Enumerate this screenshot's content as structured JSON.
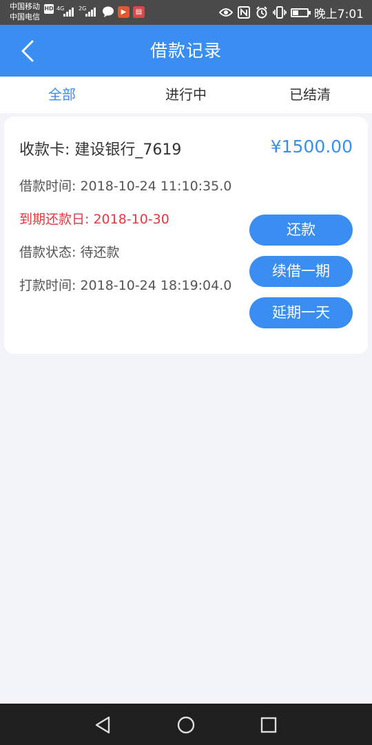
{
  "status_bar": {
    "carrier_1": "中国移动",
    "carrier_2": "中国电信",
    "hd_badge": "HD",
    "net_1": "4G",
    "net_2": "2G",
    "battery_level": 0.4,
    "time": "晚上7:01"
  },
  "header": {
    "title": "借款记录",
    "back_icon": "chevron-left-icon"
  },
  "tabs": [
    {
      "label": "全部",
      "active": true
    },
    {
      "label": "进行中",
      "active": false
    },
    {
      "label": "已结清",
      "active": false
    }
  ],
  "loan": {
    "card_label": "收款卡: 建设银行_7619",
    "amount": "¥1500.00",
    "borrow_time": "借款时间: 2018-10-24 11:10:35.0",
    "due_date": "到期还款日: 2018-10-30",
    "status": "借款状态: 待还款",
    "pay_time": "打款时间: 2018-10-24 18:19:04.0",
    "actions": {
      "repay": "还款",
      "renew": "续借一期",
      "extend": "延期一天"
    }
  },
  "colors": {
    "accent": "#3a8ef2",
    "due": "#e0393e",
    "status_bar": "#4a4a4a",
    "nav_bar": "#1f1f1f"
  }
}
